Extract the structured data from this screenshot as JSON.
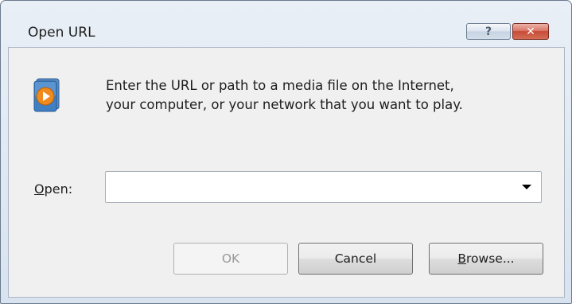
{
  "window": {
    "title": "Open URL",
    "help_label": "?",
    "close_label": "✕"
  },
  "dialog": {
    "icon": "media-player-icon",
    "description_line1": "Enter the URL or path to a media file on the Internet,",
    "description_line2": "your computer, or your network that you want to play.",
    "open_label_mnemonic": "O",
    "open_label_rest": "pen:",
    "open_value": "",
    "open_placeholder": ""
  },
  "buttons": {
    "ok_label": "OK",
    "cancel_label": "Cancel",
    "browse_mnemonic": "B",
    "browse_rest": "rowse..."
  },
  "colors": {
    "accent_orange": "#f08a1c",
    "close_red": "#c64a36"
  }
}
